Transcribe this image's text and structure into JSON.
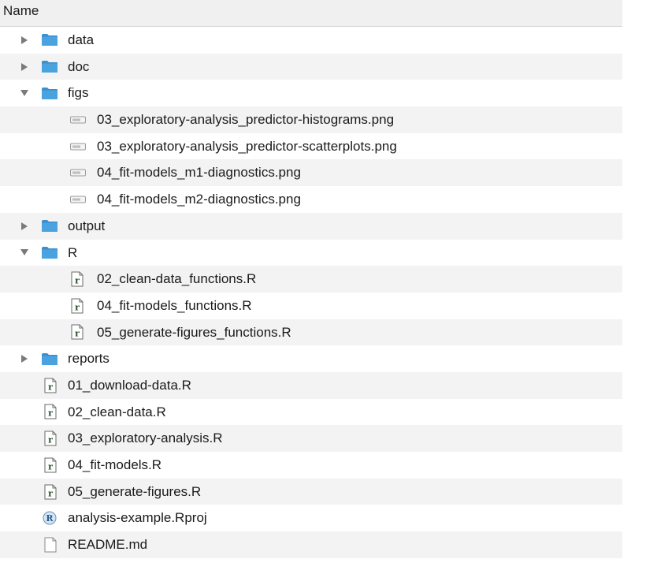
{
  "header": {
    "name_column": "Name"
  },
  "tree": [
    {
      "label": "data",
      "type": "folder",
      "level": 0,
      "expanded": false
    },
    {
      "label": "doc",
      "type": "folder",
      "level": 0,
      "expanded": false
    },
    {
      "label": "figs",
      "type": "folder",
      "level": 0,
      "expanded": true
    },
    {
      "label": "03_exploratory-analysis_predictor-histograms.png",
      "type": "png",
      "level": 1
    },
    {
      "label": "03_exploratory-analysis_predictor-scatterplots.png",
      "type": "png",
      "level": 1
    },
    {
      "label": "04_fit-models_m1-diagnostics.png",
      "type": "png",
      "level": 1
    },
    {
      "label": "04_fit-models_m2-diagnostics.png",
      "type": "png",
      "level": 1
    },
    {
      "label": "output",
      "type": "folder",
      "level": 0,
      "expanded": false
    },
    {
      "label": "R",
      "type": "folder",
      "level": 0,
      "expanded": true
    },
    {
      "label": "02_clean-data_functions.R",
      "type": "r",
      "level": 1
    },
    {
      "label": "04_fit-models_functions.R",
      "type": "r",
      "level": 1
    },
    {
      "label": "05_generate-figures_functions.R",
      "type": "r",
      "level": 1
    },
    {
      "label": "reports",
      "type": "folder",
      "level": 0,
      "expanded": false
    },
    {
      "label": "01_download-data.R",
      "type": "r",
      "level": 0
    },
    {
      "label": "02_clean-data.R",
      "type": "r",
      "level": 0
    },
    {
      "label": "03_exploratory-analysis.R",
      "type": "r",
      "level": 0
    },
    {
      "label": "04_fit-models.R",
      "type": "r",
      "level": 0
    },
    {
      "label": "05_generate-figures.R",
      "type": "r",
      "level": 0
    },
    {
      "label": "analysis-example.Rproj",
      "type": "rproj",
      "level": 0
    },
    {
      "label": "README.md",
      "type": "md",
      "level": 0
    }
  ],
  "colors": {
    "folder": "#4aa3df",
    "folder_tab": "#3b8fcb",
    "row_alt": "#f3f3f3",
    "header_bg": "#f0f0f0"
  }
}
